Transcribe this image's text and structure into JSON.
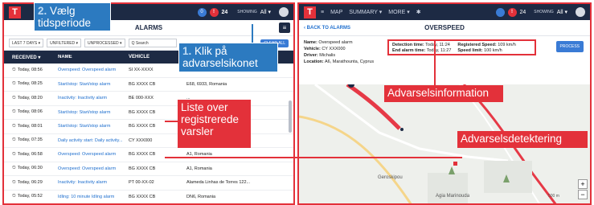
{
  "left": {
    "topbar": {
      "logo": "T",
      "showing_label": "SHOWING",
      "showing_value": "All ▾",
      "badge_blue": "0",
      "badge_red": "!",
      "count": "24"
    },
    "title": "ALARMS",
    "filters": [
      "LAST 7 DAYS ▾",
      "UNFILTERED ▾",
      "UNPROCESSED ▾",
      "Q  Search",
      "CLEAR ALL"
    ],
    "columns": [
      "RECEIVED ▾",
      "NAME",
      "VEHICLE",
      ""
    ],
    "rows": [
      {
        "time": "Today, 08:56",
        "name": "Overspeed: Overspeed alarm",
        "vehicle": "SI XX-XXXX",
        "location": ""
      },
      {
        "time": "Today, 08:25",
        "name": "Start/stop: Start/stop alarm",
        "vehicle": "BG XXXX CB",
        "location": "E68, 6933, Romania"
      },
      {
        "time": "Today, 08:20",
        "name": "Inactivity: Inactivity alarm",
        "vehicle": "BE 000-XXX",
        "location": "..."
      },
      {
        "time": "Today, 08:06",
        "name": "Start/stop: Start/stop alarm",
        "vehicle": "BG XXXX CB",
        "location": ""
      },
      {
        "time": "Today, 08:01",
        "name": "Start/stop: Start/stop alarm",
        "vehicle": "BG XXXX CB",
        "location": "...gary"
      },
      {
        "time": "Today, 07:35",
        "name": "Daily activity start: Daily activity...",
        "vehicle": "CY XXX000",
        "location": ""
      },
      {
        "time": "Today, 06:58",
        "name": "Overspeed: Overspeed alarm",
        "vehicle": "BG XXXX CB",
        "location": "A1, Romania"
      },
      {
        "time": "Today, 06:30",
        "name": "Overspeed: Overspeed alarm",
        "vehicle": "BG XXXX CB",
        "location": "A1, Romania"
      },
      {
        "time": "Today, 06:29",
        "name": "Inactivity: Inactivity alarm",
        "vehicle": "PT 00-XX-02",
        "location": "Alameda Linhas de Torres 122..."
      },
      {
        "time": "Today, 05:52",
        "name": "Idling: 10 minute Idling alarm",
        "vehicle": "BG XXXX CB",
        "location": "DN6, Romania"
      }
    ]
  },
  "right": {
    "topbar": {
      "logo": "T",
      "map": "MAP",
      "summary": "SUMMARY ▾",
      "more": "MORE ▾",
      "showing_label": "SHOWING",
      "showing_value": "All ▾",
      "count": "24"
    },
    "back": "‹ BACK TO ALARMS",
    "title": "OVERSPEED",
    "info": {
      "name": "Overspeed alarm",
      "vehicle": "CY XXX000",
      "driver": "Michalis",
      "location": "A6, Marathounta, Cyprus",
      "detection_time": "Today, 11:24",
      "end_alarm_time": "Today, 11:27",
      "registered_speed": "109 km/h",
      "speed_limit": "100 km/h"
    },
    "labels": {
      "name": "Name:",
      "vehicle": "Vehicle:",
      "driver": "Driver:",
      "location": "Location:",
      "detection_time": "Detection time:",
      "end_alarm_time": "End alarm time:",
      "registered_speed": "Registered Speed:",
      "speed_limit": "Speed limit:"
    },
    "process": "PROCESS",
    "map_labels": [
      "Geroskipou",
      "Agia Marinouda",
      "500 m"
    ]
  },
  "callouts": {
    "step2_num": "2.",
    "step2_text_a": " Vælg",
    "step2_text_b": "tidsperiode",
    "step1_num": "1.",
    "step1_text_a": " Klik på",
    "step1_text_b": "advarselsikonet",
    "list": "Liste over registrerede varsler",
    "info": "Advarselsinformation",
    "detect": "Advarselsdetektering"
  },
  "colors": {
    "accent": "#e3313a",
    "navy": "#1d2a44",
    "blue": "#2c7ac0"
  }
}
